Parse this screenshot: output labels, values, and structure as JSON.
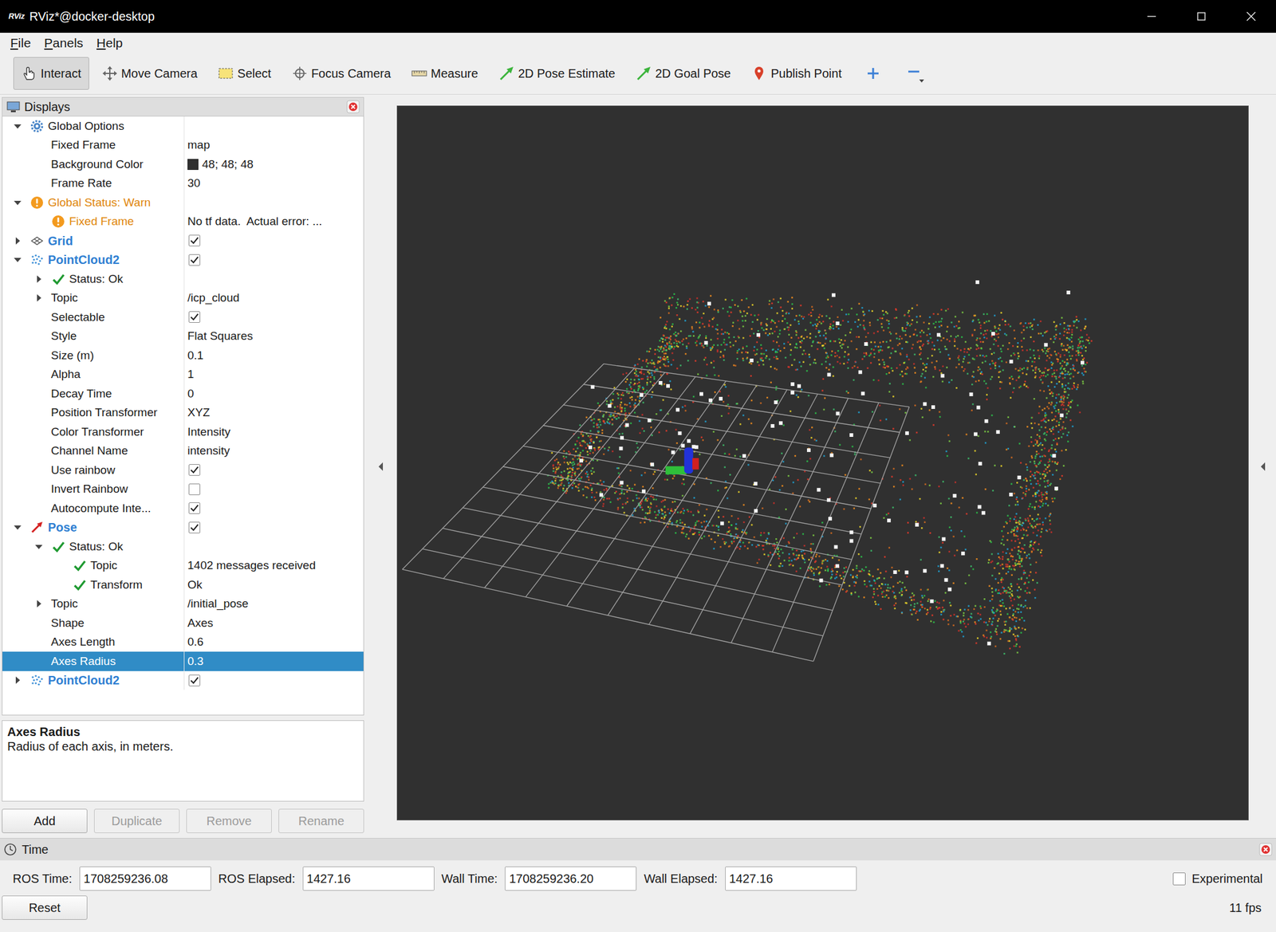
{
  "window": {
    "logo": "RViz",
    "title": "RViz*@docker-desktop"
  },
  "menu": [
    "File",
    "Panels",
    "Help"
  ],
  "toolbar": [
    {
      "label": "Interact",
      "kind": "interact",
      "selected": true
    },
    {
      "label": "Move Camera",
      "kind": "camera",
      "selected": false
    },
    {
      "label": "Select",
      "kind": "select",
      "selected": false
    },
    {
      "label": "Focus Camera",
      "kind": "focus",
      "selected": false
    },
    {
      "label": "Measure",
      "kind": "measure",
      "selected": false
    },
    {
      "label": "2D Pose Estimate",
      "kind": "estimate",
      "selected": false
    },
    {
      "label": "2D Goal Pose",
      "kind": "goal",
      "selected": false
    },
    {
      "label": "Publish Point",
      "kind": "point",
      "selected": false
    }
  ],
  "displays": {
    "title": "Displays",
    "tree": [
      {
        "label": "Global Options",
        "kind": "options",
        "expanded": true,
        "selected": false,
        "children": [
          {
            "label": "Fixed Frame",
            "value": "map",
            "kind": "property",
            "selected": false
          },
          {
            "label": "Background Color",
            "value": "48; 48; 48",
            "color": "#303030",
            "kind": "property",
            "selected": false
          },
          {
            "label": "Frame Rate",
            "value": "30",
            "kind": "property",
            "selected": false
          }
        ]
      },
      {
        "label": "Global Status: Warn",
        "kind": "warn",
        "expanded": true,
        "selected": false,
        "children": [
          {
            "label": "Fixed Frame",
            "value": "No tf data.  Actual error: ...",
            "kind": "warn",
            "selected": false
          }
        ]
      },
      {
        "label": "Grid",
        "kind": "grid",
        "expanded": false,
        "checked": true,
        "selected": false
      },
      {
        "label": "PointCloud2",
        "kind": "cloud",
        "expanded": true,
        "checked": true,
        "selected": false,
        "children": [
          {
            "label": "Status: Ok",
            "kind": "ok",
            "expanded": false,
            "selected": false
          },
          {
            "label": "Topic",
            "value": "/icp_cloud",
            "kind": "property",
            "expanded": false,
            "selected": false
          },
          {
            "label": "Selectable",
            "checked": true,
            "kind": "property",
            "selected": false
          },
          {
            "label": "Style",
            "value": "Flat Squares",
            "kind": "property",
            "selected": false
          },
          {
            "label": "Size (m)",
            "value": "0.1",
            "kind": "property",
            "selected": false
          },
          {
            "label": "Alpha",
            "value": "1",
            "kind": "property",
            "selected": false
          },
          {
            "label": "Decay Time",
            "value": "0",
            "kind": "property",
            "selected": false
          },
          {
            "label": "Position Transformer",
            "value": "XYZ",
            "kind": "property",
            "selected": false
          },
          {
            "label": "Color Transformer",
            "value": "Intensity",
            "kind": "property",
            "selected": false
          },
          {
            "label": "Channel Name",
            "value": "intensity",
            "kind": "property",
            "selected": false
          },
          {
            "label": "Use rainbow",
            "checked": true,
            "kind": "property",
            "selected": false
          },
          {
            "label": "Invert Rainbow",
            "checked": false,
            "kind": "property",
            "selected": false
          },
          {
            "label": "Autocompute Inte...",
            "checked": true,
            "kind": "property",
            "selected": false
          }
        ]
      },
      {
        "label": "Pose",
        "kind": "pose",
        "expanded": true,
        "checked": true,
        "selected": false,
        "children": [
          {
            "label": "Status: Ok",
            "kind": "ok",
            "expanded": true,
            "selected": false,
            "children": [
              {
                "label": "Topic",
                "value": "1402 messages received",
                "kind": "ok",
                "selected": false
              },
              {
                "label": "Transform",
                "value": "Ok",
                "kind": "ok",
                "selected": false
              }
            ]
          },
          {
            "label": "Topic",
            "value": "/initial_pose",
            "kind": "property",
            "expanded": false,
            "selected": false
          },
          {
            "label": "Shape",
            "value": "Axes",
            "kind": "property",
            "selected": false
          },
          {
            "label": "Axes Length",
            "value": "0.6",
            "kind": "property",
            "selected": false
          },
          {
            "label": "Axes Radius",
            "value": "0.3",
            "kind": "property",
            "selected": true
          }
        ]
      },
      {
        "label": "PointCloud2",
        "kind": "cloud",
        "expanded": false,
        "checked": true,
        "selected": false
      }
    ],
    "description": {
      "title": "Axes Radius",
      "text": "Radius of each axis, in meters."
    },
    "buttons": [
      {
        "label": "Add",
        "disabled": false
      },
      {
        "label": "Duplicate",
        "disabled": true
      },
      {
        "label": "Remove",
        "disabled": true
      },
      {
        "label": "Rename",
        "disabled": true
      }
    ]
  },
  "time": {
    "title": "Time",
    "fields": [
      {
        "label": "ROS Time:",
        "value": "1708259236.08"
      },
      {
        "label": "ROS Elapsed:",
        "value": "1427.16"
      },
      {
        "label": "Wall Time:",
        "value": "1708259236.20"
      },
      {
        "label": "Wall Elapsed:",
        "value": "1427.16"
      }
    ],
    "experimental": {
      "label": "Experimental",
      "checked": false
    },
    "reset": "Reset",
    "fps": "11 fps"
  }
}
